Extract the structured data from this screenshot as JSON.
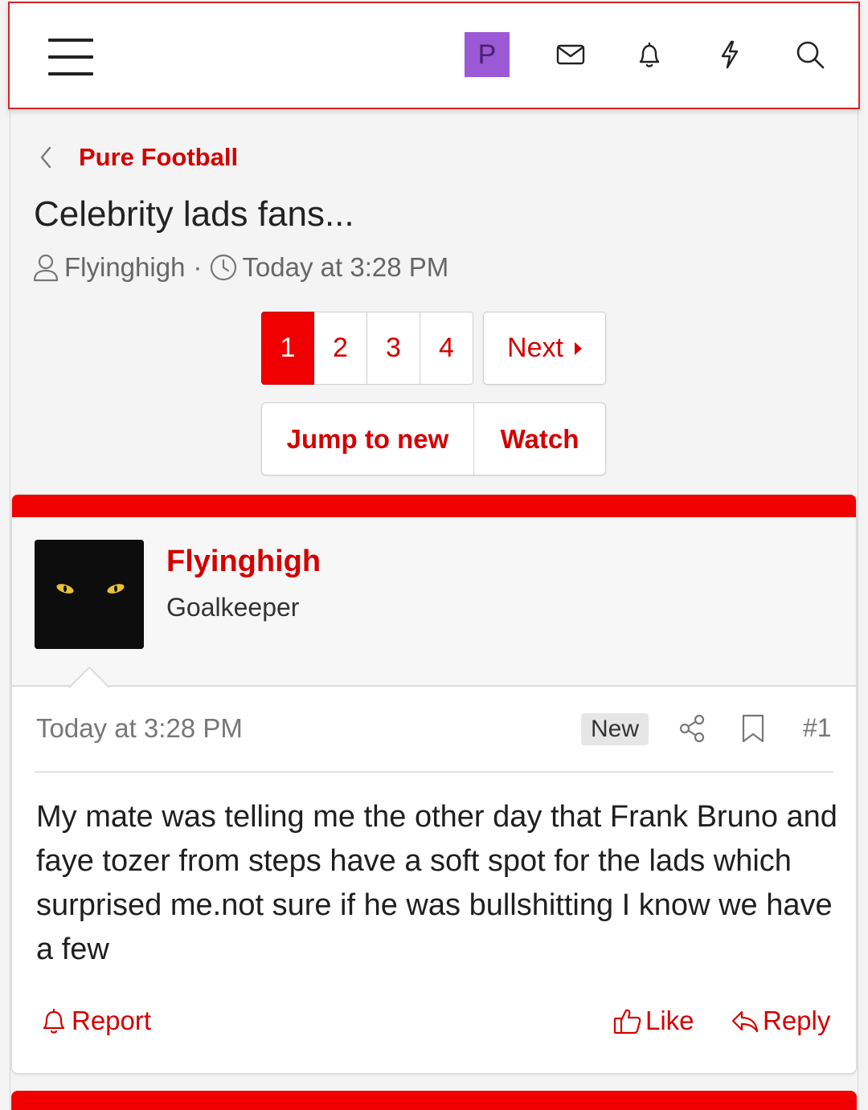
{
  "colors": {
    "accent": "#d40000",
    "current_page_bg": "#f00000",
    "avatar_bg": "#9b59d6",
    "post_band": "#f00000"
  },
  "header": {
    "menu_icon": "hamburger-icon",
    "account_letter": "P",
    "icons": [
      "envelope-icon",
      "bell-icon",
      "lightning-icon",
      "search-icon"
    ]
  },
  "breadcrumb": {
    "back_icon": "chevron-left-icon",
    "label": "Pure Football"
  },
  "thread": {
    "title": "Celebrity lads fans...",
    "author": "Flyinghigh",
    "separator": "·",
    "time": "Today at 3:28 PM"
  },
  "pagination": {
    "pages": [
      "1",
      "2",
      "3",
      "4"
    ],
    "current": "1",
    "next_label": "Next"
  },
  "actions": {
    "jump_label": "Jump to new",
    "watch_label": "Watch"
  },
  "post": {
    "username": "Flyinghigh",
    "user_title": "Goalkeeper",
    "date": "Today at 3:28 PM",
    "badge": "New",
    "number": "#1",
    "body": "My mate was telling me the other day that Frank Bruno and faye tozer from steps have a soft spot for the lads which surprised me.not sure if he was bullshitting I know we have a few",
    "report_label": "Report",
    "like_label": "Like",
    "reply_label": "Reply"
  }
}
